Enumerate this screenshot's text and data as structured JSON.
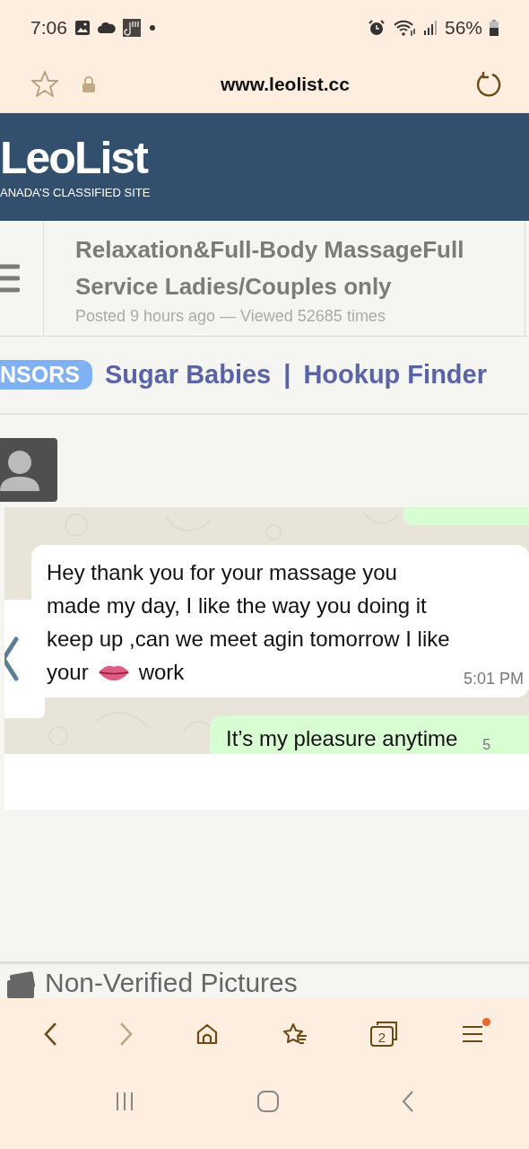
{
  "status_bar": {
    "time": "7:06",
    "battery": "56%"
  },
  "browser": {
    "url": "www.leolist.cc"
  },
  "site_header": {
    "logo": "LeoList",
    "tagline": "ANADA’S CLASSIFIED SITE"
  },
  "listing": {
    "title": "Relaxation&Full-Body MassageFull Service Ladies/Couples only",
    "meta": "Posted 9 hours ago — Viewed 52685 times"
  },
  "sponsors": {
    "badge": "NSORS",
    "separator": "|",
    "links": [
      "Sugar Babies",
      "Hookup Finder"
    ]
  },
  "chat": {
    "messages": [
      {
        "kind": "incoming",
        "lines": [
          "Hey thank you for your massage you",
          "made my day, I like the way you doing it",
          "keep up ,can we meet agin tomorrow I like"
        ],
        "text_before": "your",
        "text_after": "work",
        "time": "5:01 PM"
      },
      {
        "kind": "outgoing",
        "text": "It’s my pleasure anytime",
        "time": "5"
      }
    ]
  },
  "section_heading": "Non-Verified Pictures",
  "toolbar": [
    {
      "kind": "back",
      "disabled": false
    },
    {
      "kind": "forward",
      "disabled": true
    },
    {
      "kind": "home",
      "disabled": false
    },
    {
      "kind": "bookmarks",
      "disabled": false
    },
    {
      "kind": "tabs",
      "disabled": false,
      "count": "2"
    },
    {
      "kind": "menu",
      "disabled": false,
      "notification": true
    }
  ]
}
